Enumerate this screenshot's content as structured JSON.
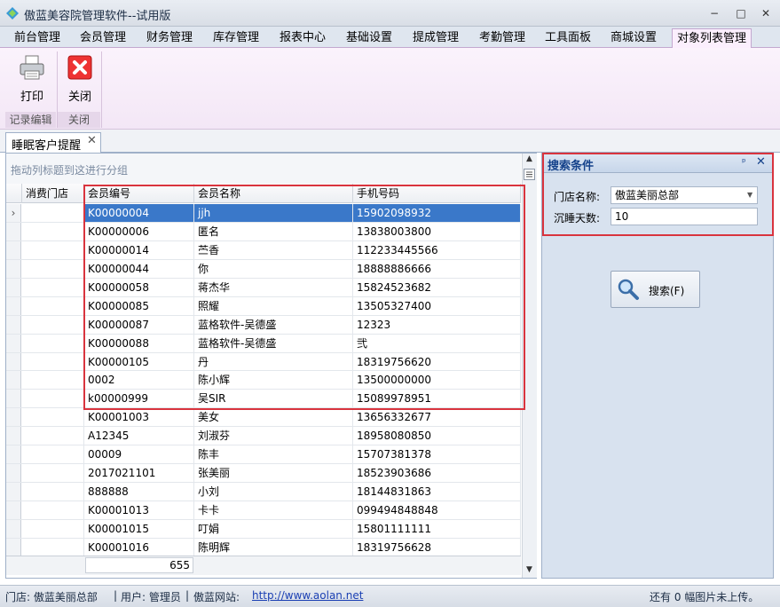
{
  "window": {
    "title": "傲蓝美容院管理软件--试用版",
    "controls": [
      "−",
      "□",
      "✕"
    ]
  },
  "tabs": [
    "前台管理",
    "会员管理",
    "财务管理",
    "库存管理",
    "报表中心",
    "基础设置",
    "提成管理",
    "考勤管理",
    "工具面板",
    "商城设置",
    "对象列表管理"
  ],
  "active_tab": "对象列表管理",
  "ribbon": {
    "print_label": "打印",
    "close_label": "关闭",
    "group_record": "记录编辑",
    "group_close": "关闭"
  },
  "doc_tab": {
    "label": "睡眠客户提醒",
    "close": "✕"
  },
  "grid": {
    "group_hint": "拖动列标题到这进行分组",
    "columns": [
      "消费门店",
      "会员编号",
      "会员名称",
      "手机号码"
    ],
    "rows": [
      {
        "store": "",
        "id": "K00000004",
        "name": "jjh",
        "phone": "15902098932",
        "selected": true
      },
      {
        "store": "",
        "id": "K00000006",
        "name": "匿名",
        "phone": "13838003800"
      },
      {
        "store": "",
        "id": "K00000014",
        "name": "苎香",
        "phone": "112233445566"
      },
      {
        "store": "",
        "id": "K00000044",
        "name": "你",
        "phone": "18888886666"
      },
      {
        "store": "",
        "id": "K00000058",
        "name": "蒋杰华",
        "phone": "15824523682"
      },
      {
        "store": "",
        "id": "K00000085",
        "name": "照耀",
        "phone": "13505327400"
      },
      {
        "store": "",
        "id": "K00000087",
        "name": "蓝格软件-吴德盛",
        "phone": "12323"
      },
      {
        "store": "",
        "id": "K00000088",
        "name": "蓝格软件-吴德盛",
        "phone": "弐"
      },
      {
        "store": "",
        "id": "K00000105",
        "name": "丹",
        "phone": "18319756620"
      },
      {
        "store": "",
        "id": "0002",
        "name": "陈小辉",
        "phone": "13500000000"
      },
      {
        "store": "",
        "id": "k00000999",
        "name": "吴SIR",
        "phone": "15089978951"
      },
      {
        "store": "",
        "id": "K00001003",
        "name": "美女",
        "phone": "13656332677"
      },
      {
        "store": "",
        "id": "A12345",
        "name": "刘淑芬",
        "phone": "18958080850"
      },
      {
        "store": "",
        "id": "00009",
        "name": "陈丰",
        "phone": "15707381378"
      },
      {
        "store": "",
        "id": "2017021101",
        "name": "张美丽",
        "phone": "18523903686"
      },
      {
        "store": "",
        "id": "888888",
        "name": "小刘",
        "phone": "18144831863"
      },
      {
        "store": "",
        "id": "K00001013",
        "name": "卡卡",
        "phone": "099494848848"
      },
      {
        "store": "",
        "id": "K00001015",
        "name": "叮娟",
        "phone": "15801111111"
      },
      {
        "store": "",
        "id": "K00001016",
        "name": "陈明辉",
        "phone": "18319756628"
      }
    ],
    "footer_count": "655"
  },
  "search_panel": {
    "title": "搜索条件",
    "store_label": "门店名称:",
    "store_value": "傲蓝美丽总部",
    "days_label": "沉睡天数:",
    "days_value": "10",
    "search_button": "搜索(F)"
  },
  "status_bar": {
    "store": "门店: 傲蓝美丽总部",
    "user": "用户: 管理员",
    "site_label": "傲蓝网站:",
    "site_url": "http://www.aolan.net",
    "right_text": "还有 0 幅图片未上传。"
  },
  "colors": {
    "annotation": "#d9343e",
    "selection": "#3a78c9",
    "panel_title": "#15428b"
  }
}
